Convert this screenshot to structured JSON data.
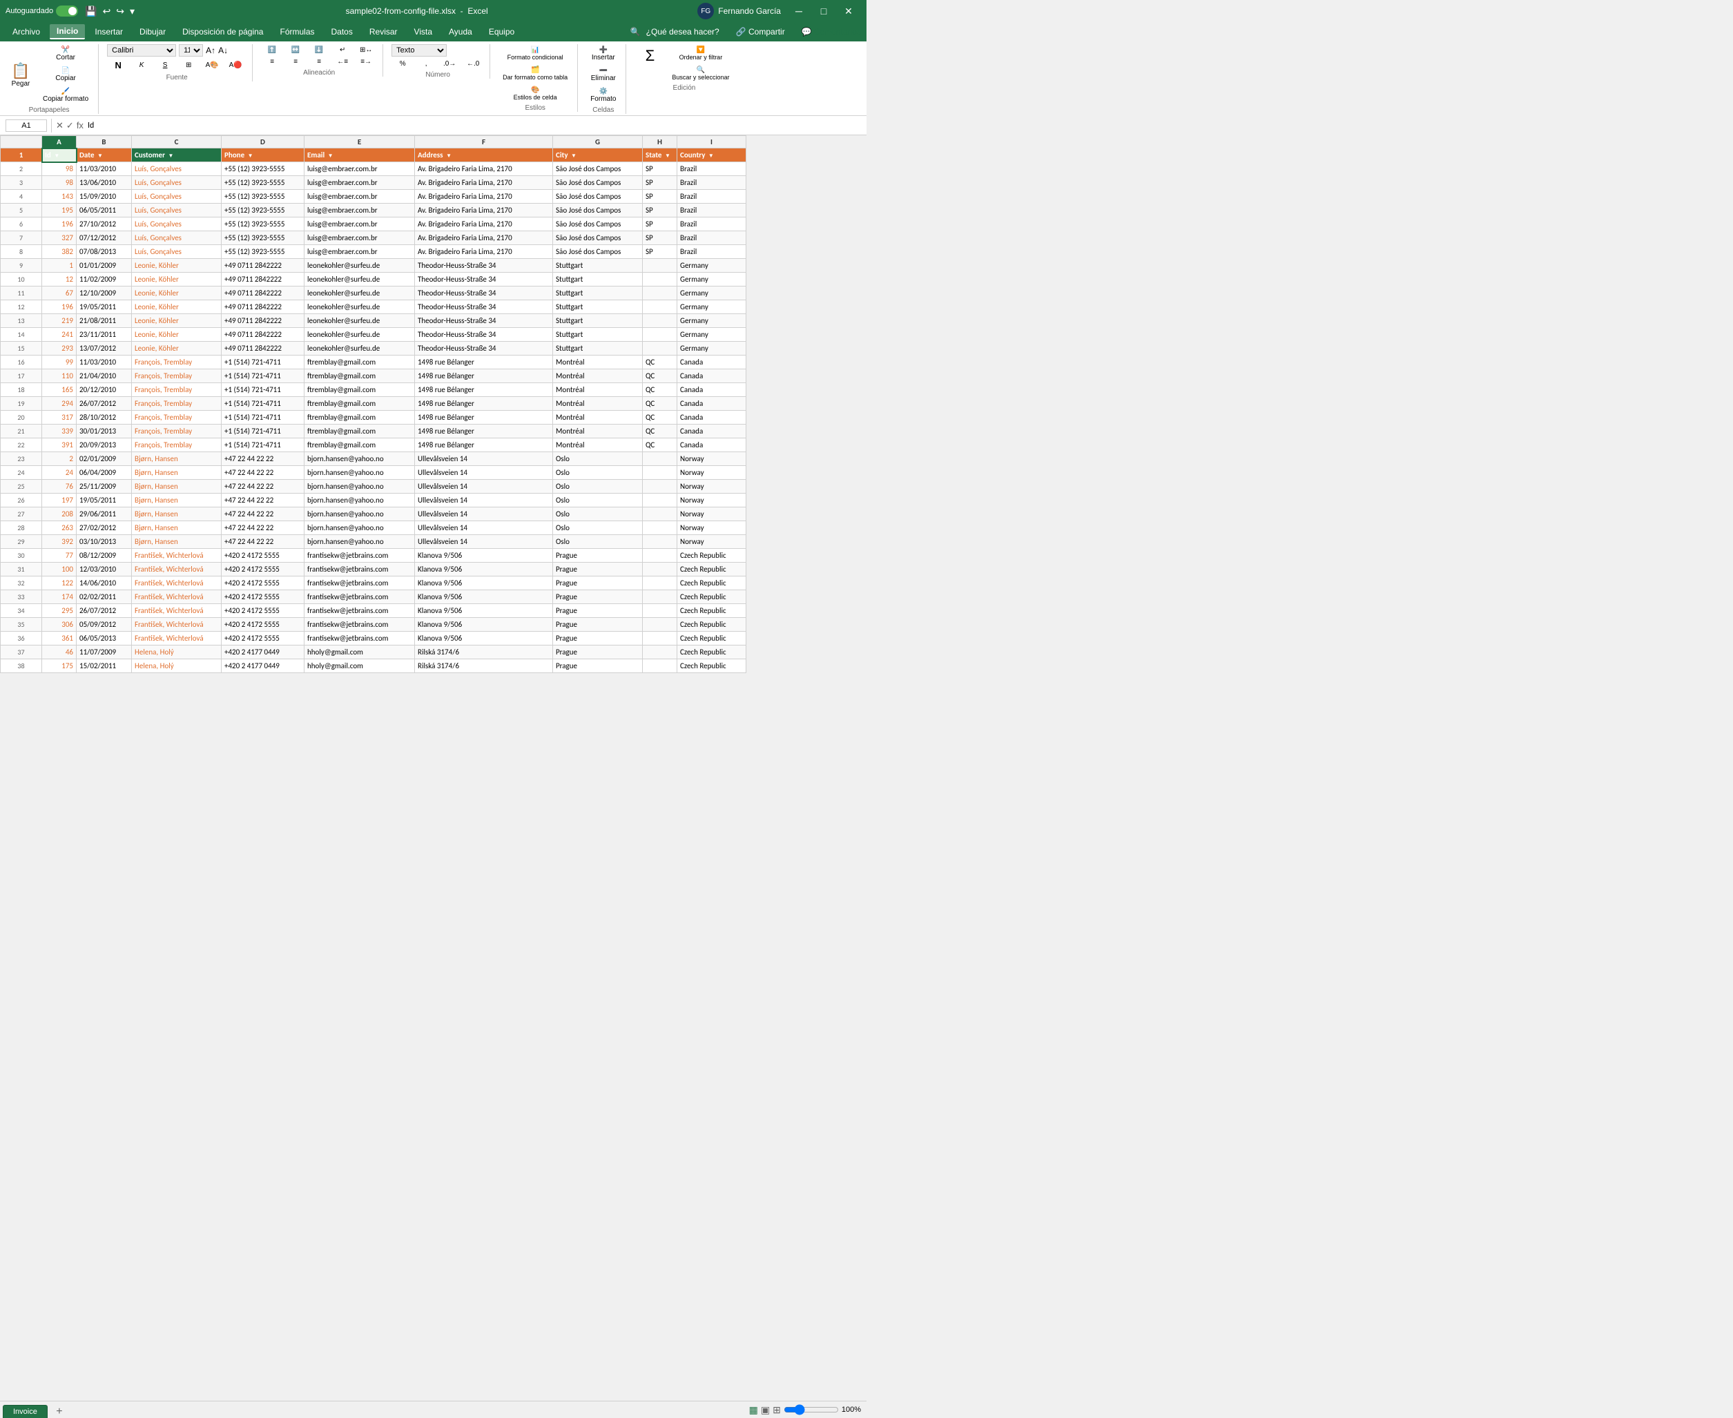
{
  "titleBar": {
    "autosave_label": "Autoguardado",
    "file_name": "sample02-from-config-file.xlsx",
    "app_name": "Excel",
    "user_name": "Fernando García",
    "save_icon": "💾",
    "undo_icon": "↩",
    "redo_icon": "↪",
    "dropdown_icon": "▾"
  },
  "menuBar": {
    "items": [
      "Archivo",
      "Inicio",
      "Insertar",
      "Dibujar",
      "Disposición de página",
      "Fórmulas",
      "Datos",
      "Revisar",
      "Vista",
      "Ayuda",
      "Equipo"
    ],
    "active_item": "Inicio",
    "search_placeholder": "¿Qué desea hacer?",
    "share_label": "Compartir",
    "comments_label": "Comentarios"
  },
  "ribbon": {
    "paste_label": "Pegar",
    "clipboard_label": "Portapapeles",
    "font_name": "Calibri",
    "font_size": "11",
    "font_label": "Fuente",
    "bold": "N",
    "italic": "K",
    "underline": "S",
    "alignment_label": "Alineación",
    "number_format": "Texto",
    "number_label": "Número",
    "conditional_format": "Formato condicional",
    "table_format": "Dar formato como tabla",
    "cell_styles": "Estilos de celda",
    "styles_label": "Estilos",
    "insert_label": "Insertar",
    "delete_label": "Eliminar",
    "format_label": "Formato",
    "cells_label": "Celdas",
    "sum_label": "Σ",
    "sort_filter_label": "Ordenar y filtrar",
    "find_select_label": "Buscar y seleccionar",
    "edition_label": "Edición"
  },
  "formulaBar": {
    "cell_ref": "A1",
    "formula_content": "Id"
  },
  "columns": {
    "headers": [
      "",
      "A",
      "B",
      "C",
      "D",
      "E",
      "F",
      "G",
      "H",
      "I"
    ],
    "widths": [
      30,
      50,
      80,
      120,
      120,
      160,
      200,
      120,
      60,
      100
    ]
  },
  "dataHeaders": {
    "row": [
      "",
      "Id",
      "Date",
      "Customer",
      "Phone",
      "Email",
      "Address",
      "City",
      "State",
      "Country"
    ]
  },
  "rows": [
    {
      "num": "2",
      "id": "98",
      "date": "11/03/2010",
      "customer": "Luís, Gonçalves",
      "phone": "+55 (12) 3923-5555",
      "email": "luisg@embraer.com.br",
      "address": "Av. Brigadeiro Faria Lima, 2170",
      "city": "São José dos Campos",
      "state": "SP",
      "country": "Brazil"
    },
    {
      "num": "3",
      "id": "98",
      "date": "13/06/2010",
      "customer": "Luís, Gonçalves",
      "phone": "+55 (12) 3923-5555",
      "email": "luisg@embraer.com.br",
      "address": "Av. Brigadeiro Faria Lima, 2170",
      "city": "São José dos Campos",
      "state": "SP",
      "country": "Brazil"
    },
    {
      "num": "4",
      "id": "143",
      "date": "15/09/2010",
      "customer": "Luís, Gonçalves",
      "phone": "+55 (12) 3923-5555",
      "email": "luisg@embraer.com.br",
      "address": "Av. Brigadeiro Faria Lima, 2170",
      "city": "São José dos Campos",
      "state": "SP",
      "country": "Brazil"
    },
    {
      "num": "5",
      "id": "195",
      "date": "06/05/2011",
      "customer": "Luís, Gonçalves",
      "phone": "+55 (12) 3923-5555",
      "email": "luisg@embraer.com.br",
      "address": "Av. Brigadeiro Faria Lima, 2170",
      "city": "São José dos Campos",
      "state": "SP",
      "country": "Brazil"
    },
    {
      "num": "6",
      "id": "196",
      "date": "27/10/2012",
      "customer": "Luís, Gonçalves",
      "phone": "+55 (12) 3923-5555",
      "email": "luisg@embraer.com.br",
      "address": "Av. Brigadeiro Faria Lima, 2170",
      "city": "São José dos Campos",
      "state": "SP",
      "country": "Brazil"
    },
    {
      "num": "7",
      "id": "327",
      "date": "07/12/2012",
      "customer": "Luís, Gonçalves",
      "phone": "+55 (12) 3923-5555",
      "email": "luisg@embraer.com.br",
      "address": "Av. Brigadeiro Faria Lima, 2170",
      "city": "São José dos Campos",
      "state": "SP",
      "country": "Brazil"
    },
    {
      "num": "8",
      "id": "382",
      "date": "07/08/2013",
      "customer": "Luís, Gonçalves",
      "phone": "+55 (12) 3923-5555",
      "email": "luisg@embraer.com.br",
      "address": "Av. Brigadeiro Faria Lima, 2170",
      "city": "São José dos Campos",
      "state": "SP",
      "country": "Brazil"
    },
    {
      "num": "9",
      "id": "1",
      "date": "01/01/2009",
      "customer": "Leonie, Köhler",
      "phone": "+49 0711 2842222",
      "email": "leonekohler@surfeu.de",
      "address": "Theodor-Heuss-Straße 34",
      "city": "Stuttgart",
      "state": "",
      "country": "Germany"
    },
    {
      "num": "10",
      "id": "12",
      "date": "11/02/2009",
      "customer": "Leonie, Köhler",
      "phone": "+49 0711 2842222",
      "email": "leonekohler@surfeu.de",
      "address": "Theodor-Heuss-Straße 34",
      "city": "Stuttgart",
      "state": "",
      "country": "Germany"
    },
    {
      "num": "11",
      "id": "67",
      "date": "12/10/2009",
      "customer": "Leonie, Köhler",
      "phone": "+49 0711 2842222",
      "email": "leonekohler@surfeu.de",
      "address": "Theodor-Heuss-Straße 34",
      "city": "Stuttgart",
      "state": "",
      "country": "Germany"
    },
    {
      "num": "12",
      "id": "196",
      "date": "19/05/2011",
      "customer": "Leonie, Köhler",
      "phone": "+49 0711 2842222",
      "email": "leonekohler@surfeu.de",
      "address": "Theodor-Heuss-Straße 34",
      "city": "Stuttgart",
      "state": "",
      "country": "Germany"
    },
    {
      "num": "13",
      "id": "219",
      "date": "21/08/2011",
      "customer": "Leonie, Köhler",
      "phone": "+49 0711 2842222",
      "email": "leonekohler@surfeu.de",
      "address": "Theodor-Heuss-Straße 34",
      "city": "Stuttgart",
      "state": "",
      "country": "Germany"
    },
    {
      "num": "14",
      "id": "241",
      "date": "23/11/2011",
      "customer": "Leonie, Köhler",
      "phone": "+49 0711 2842222",
      "email": "leonekohler@surfeu.de",
      "address": "Theodor-Heuss-Straße 34",
      "city": "Stuttgart",
      "state": "",
      "country": "Germany"
    },
    {
      "num": "15",
      "id": "293",
      "date": "13/07/2012",
      "customer": "Leonie, Köhler",
      "phone": "+49 0711 2842222",
      "email": "leonekohler@surfeu.de",
      "address": "Theodor-Heuss-Straße 34",
      "city": "Stuttgart",
      "state": "",
      "country": "Germany"
    },
    {
      "num": "16",
      "id": "99",
      "date": "11/03/2010",
      "customer": "François, Tremblay",
      "phone": "+1 (514) 721-4711",
      "email": "ftremblay@gmail.com",
      "address": "1498 rue Bélanger",
      "city": "Montréal",
      "state": "QC",
      "country": "Canada"
    },
    {
      "num": "17",
      "id": "110",
      "date": "21/04/2010",
      "customer": "François, Tremblay",
      "phone": "+1 (514) 721-4711",
      "email": "ftremblay@gmail.com",
      "address": "1498 rue Bélanger",
      "city": "Montréal",
      "state": "QC",
      "country": "Canada"
    },
    {
      "num": "18",
      "id": "165",
      "date": "20/12/2010",
      "customer": "François, Tremblay",
      "phone": "+1 (514) 721-4711",
      "email": "ftremblay@gmail.com",
      "address": "1498 rue Bélanger",
      "city": "Montréal",
      "state": "QC",
      "country": "Canada"
    },
    {
      "num": "19",
      "id": "294",
      "date": "26/07/2012",
      "customer": "François, Tremblay",
      "phone": "+1 (514) 721-4711",
      "email": "ftremblay@gmail.com",
      "address": "1498 rue Bélanger",
      "city": "Montréal",
      "state": "QC",
      "country": "Canada"
    },
    {
      "num": "20",
      "id": "317",
      "date": "28/10/2012",
      "customer": "François, Tremblay",
      "phone": "+1 (514) 721-4711",
      "email": "ftremblay@gmail.com",
      "address": "1498 rue Bélanger",
      "city": "Montréal",
      "state": "QC",
      "country": "Canada"
    },
    {
      "num": "21",
      "id": "339",
      "date": "30/01/2013",
      "customer": "François, Tremblay",
      "phone": "+1 (514) 721-4711",
      "email": "ftremblay@gmail.com",
      "address": "1498 rue Bélanger",
      "city": "Montréal",
      "state": "QC",
      "country": "Canada"
    },
    {
      "num": "22",
      "id": "391",
      "date": "20/09/2013",
      "customer": "François, Tremblay",
      "phone": "+1 (514) 721-4711",
      "email": "ftremblay@gmail.com",
      "address": "1498 rue Bélanger",
      "city": "Montréal",
      "state": "QC",
      "country": "Canada"
    },
    {
      "num": "23",
      "id": "2",
      "date": "02/01/2009",
      "customer": "Bjørn, Hansen",
      "phone": "+47 22 44 22 22",
      "email": "bjorn.hansen@yahoo.no",
      "address": "Ullevålsveien 14",
      "city": "Oslo",
      "state": "",
      "country": "Norway"
    },
    {
      "num": "24",
      "id": "24",
      "date": "06/04/2009",
      "customer": "Bjørn, Hansen",
      "phone": "+47 22 44 22 22",
      "email": "bjorn.hansen@yahoo.no",
      "address": "Ullevålsveien 14",
      "city": "Oslo",
      "state": "",
      "country": "Norway"
    },
    {
      "num": "25",
      "id": "76",
      "date": "25/11/2009",
      "customer": "Bjørn, Hansen",
      "phone": "+47 22 44 22 22",
      "email": "bjorn.hansen@yahoo.no",
      "address": "Ullevålsveien 14",
      "city": "Oslo",
      "state": "",
      "country": "Norway"
    },
    {
      "num": "26",
      "id": "197",
      "date": "19/05/2011",
      "customer": "Bjørn, Hansen",
      "phone": "+47 22 44 22 22",
      "email": "bjorn.hansen@yahoo.no",
      "address": "Ullevålsveien 14",
      "city": "Oslo",
      "state": "",
      "country": "Norway"
    },
    {
      "num": "27",
      "id": "208",
      "date": "29/06/2011",
      "customer": "Bjørn, Hansen",
      "phone": "+47 22 44 22 22",
      "email": "bjorn.hansen@yahoo.no",
      "address": "Ullevålsveien 14",
      "city": "Oslo",
      "state": "",
      "country": "Norway"
    },
    {
      "num": "28",
      "id": "263",
      "date": "27/02/2012",
      "customer": "Bjørn, Hansen",
      "phone": "+47 22 44 22 22",
      "email": "bjorn.hansen@yahoo.no",
      "address": "Ullevålsveien 14",
      "city": "Oslo",
      "state": "",
      "country": "Norway"
    },
    {
      "num": "29",
      "id": "392",
      "date": "03/10/2013",
      "customer": "Bjørn, Hansen",
      "phone": "+47 22 44 22 22",
      "email": "bjorn.hansen@yahoo.no",
      "address": "Ullevålsveien 14",
      "city": "Oslo",
      "state": "",
      "country": "Norway"
    },
    {
      "num": "30",
      "id": "77",
      "date": "08/12/2009",
      "customer": "František, Wichterlová",
      "phone": "+420 2 4172 5555",
      "email": "frantisekw@jetbrains.com",
      "address": "Klanova 9/506",
      "city": "Prague",
      "state": "",
      "country": "Czech Republic"
    },
    {
      "num": "31",
      "id": "100",
      "date": "12/03/2010",
      "customer": "František, Wichterlová",
      "phone": "+420 2 4172 5555",
      "email": "frantisekw@jetbrains.com",
      "address": "Klanova 9/506",
      "city": "Prague",
      "state": "",
      "country": "Czech Republic"
    },
    {
      "num": "32",
      "id": "122",
      "date": "14/06/2010",
      "customer": "František, Wichterlová",
      "phone": "+420 2 4172 5555",
      "email": "frantisekw@jetbrains.com",
      "address": "Klanova 9/506",
      "city": "Prague",
      "state": "",
      "country": "Czech Republic"
    },
    {
      "num": "33",
      "id": "174",
      "date": "02/02/2011",
      "customer": "František, Wichterlová",
      "phone": "+420 2 4172 5555",
      "email": "frantisekw@jetbrains.com",
      "address": "Klanova 9/506",
      "city": "Prague",
      "state": "",
      "country": "Czech Republic"
    },
    {
      "num": "34",
      "id": "295",
      "date": "26/07/2012",
      "customer": "František, Wichterlová",
      "phone": "+420 2 4172 5555",
      "email": "frantisekw@jetbrains.com",
      "address": "Klanova 9/506",
      "city": "Prague",
      "state": "",
      "country": "Czech Republic"
    },
    {
      "num": "35",
      "id": "306",
      "date": "05/09/2012",
      "customer": "František, Wichterlová",
      "phone": "+420 2 4172 5555",
      "email": "frantisekw@jetbrains.com",
      "address": "Klanova 9/506",
      "city": "Prague",
      "state": "",
      "country": "Czech Republic"
    },
    {
      "num": "36",
      "id": "361",
      "date": "06/05/2013",
      "customer": "František, Wichterlová",
      "phone": "+420 2 4172 5555",
      "email": "frantisekw@jetbrains.com",
      "address": "Klanova 9/506",
      "city": "Prague",
      "state": "",
      "country": "Czech Republic"
    },
    {
      "num": "37",
      "id": "46",
      "date": "11/07/2009",
      "customer": "Helena, Holý",
      "phone": "+420 2 4177 0449",
      "email": "hholy@gmail.com",
      "address": "Rilská 3174/6",
      "city": "Prague",
      "state": "",
      "country": "Czech Republic"
    },
    {
      "num": "38",
      "id": "175",
      "date": "15/02/2011",
      "customer": "Helena, Holý",
      "phone": "+420 2 4177 0449",
      "email": "hholy@gmail.com",
      "address": "Rilská 3174/6",
      "city": "Prague",
      "state": "",
      "country": "Czech Republic"
    }
  ],
  "sheetTabs": {
    "active_tab": "Invoice",
    "add_icon": "+"
  },
  "statusBar": {
    "zoom_label": "100%",
    "view_normal": "▦",
    "view_layout": "▣",
    "view_page": "⊞"
  }
}
